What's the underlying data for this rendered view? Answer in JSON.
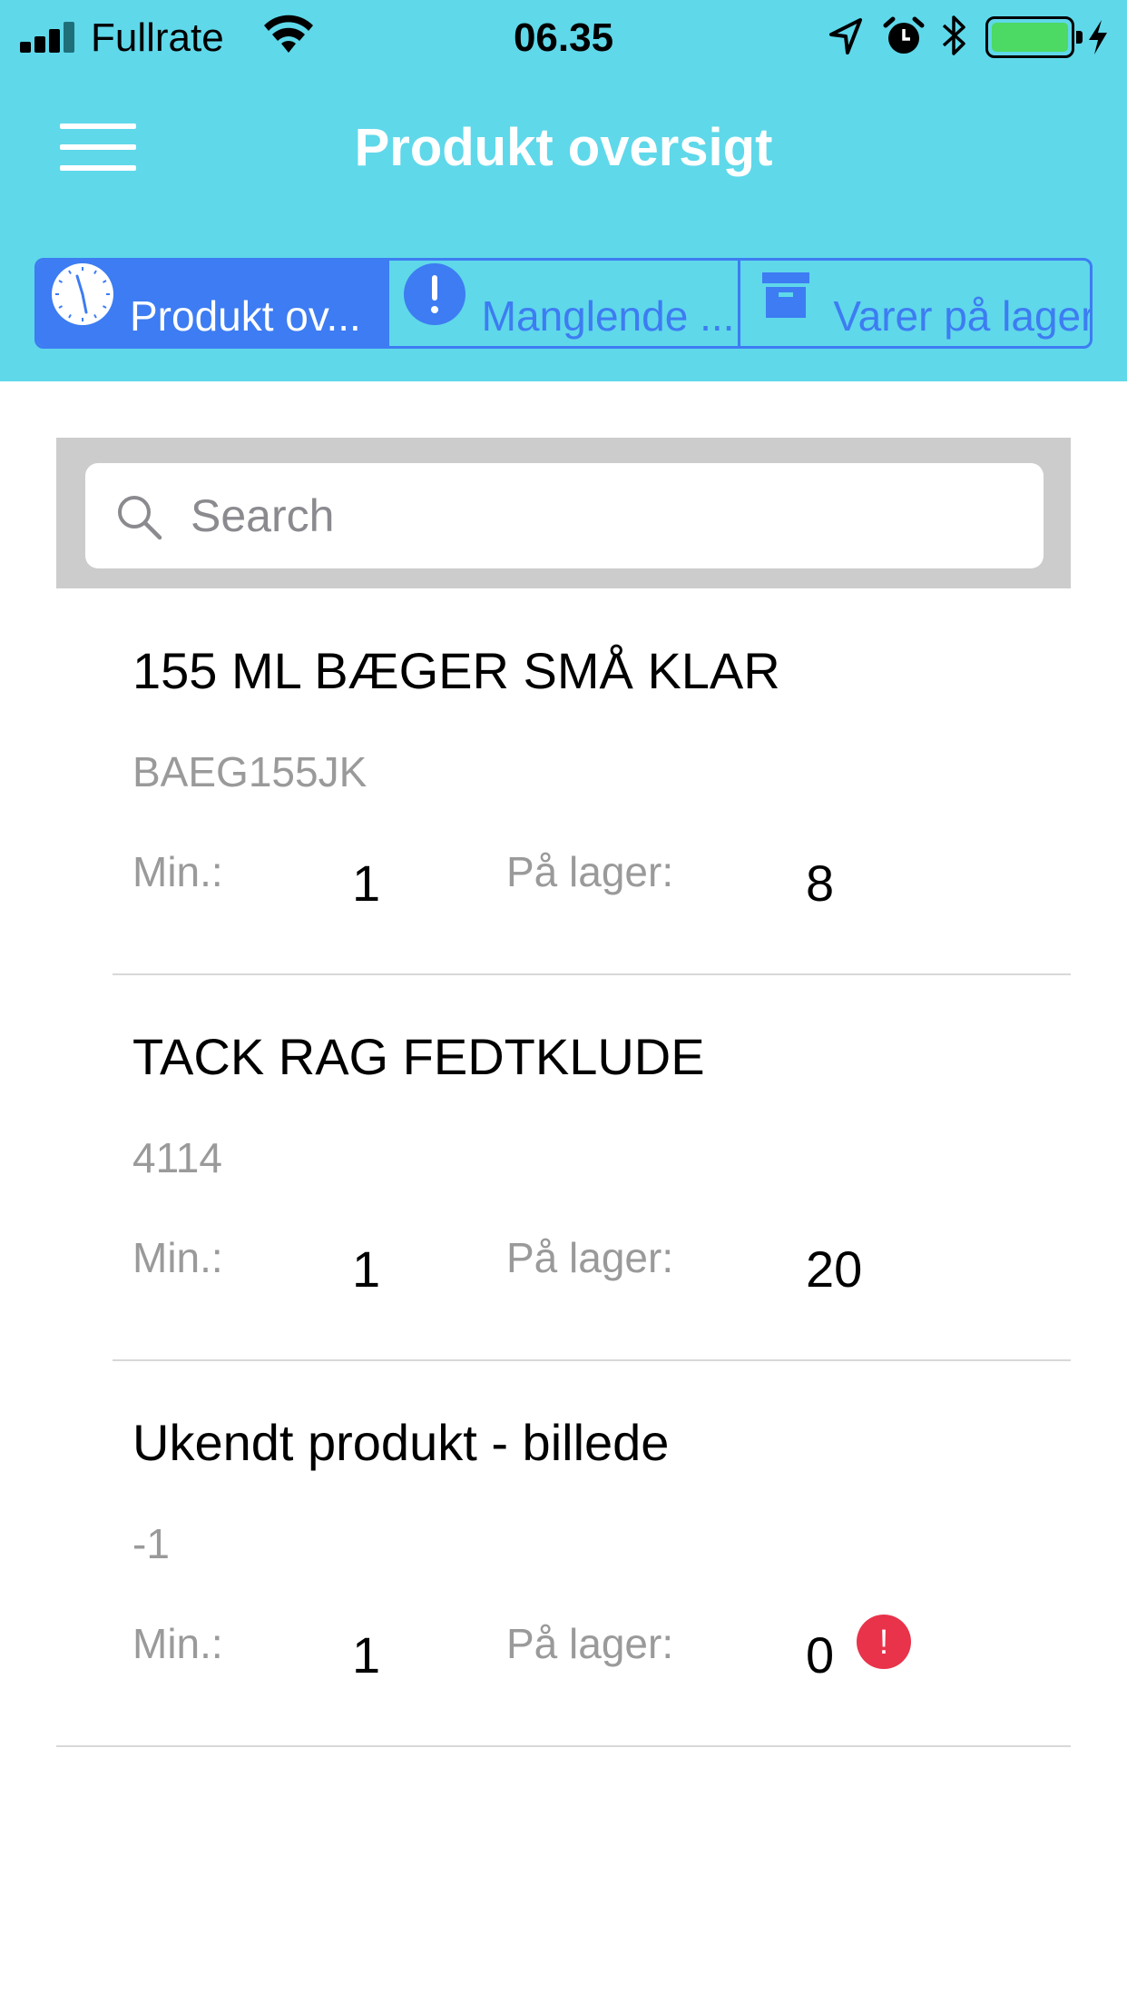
{
  "status_bar": {
    "carrier": "Fullrate",
    "time": "06.35",
    "battery_level": 1.0
  },
  "header": {
    "title": "Produkt oversigt",
    "menu_icon": "hamburger-icon",
    "background_color": "#5fd8ea"
  },
  "tabs": [
    {
      "label": "Produkt ov...",
      "icon": "clock-icon",
      "active": true
    },
    {
      "label": "Manglende ...",
      "icon": "exclamation-circle-icon",
      "active": false
    },
    {
      "label": "Varer på lager",
      "icon": "archive-box-icon",
      "active": false
    }
  ],
  "search": {
    "placeholder": "Search",
    "value": ""
  },
  "labels": {
    "min": "Min.:",
    "stock": "På lager:"
  },
  "products": [
    {
      "name": "155 ML BÆGER SMÅ KLAR",
      "code": "BAEG155JK",
      "min": "1",
      "stock": "8",
      "alert": false
    },
    {
      "name": "TACK RAG FEDTKLUDE",
      "code": "4114",
      "min": "1",
      "stock": "20",
      "alert": false
    },
    {
      "name": "Ukendt produkt - billede",
      "code": "-1",
      "min": "1",
      "stock": "0",
      "alert": true,
      "alert_symbol": "!"
    }
  ],
  "colors": {
    "accent": "#3d7cf2",
    "alert": "#e8334a",
    "battery": "#4cd964"
  }
}
